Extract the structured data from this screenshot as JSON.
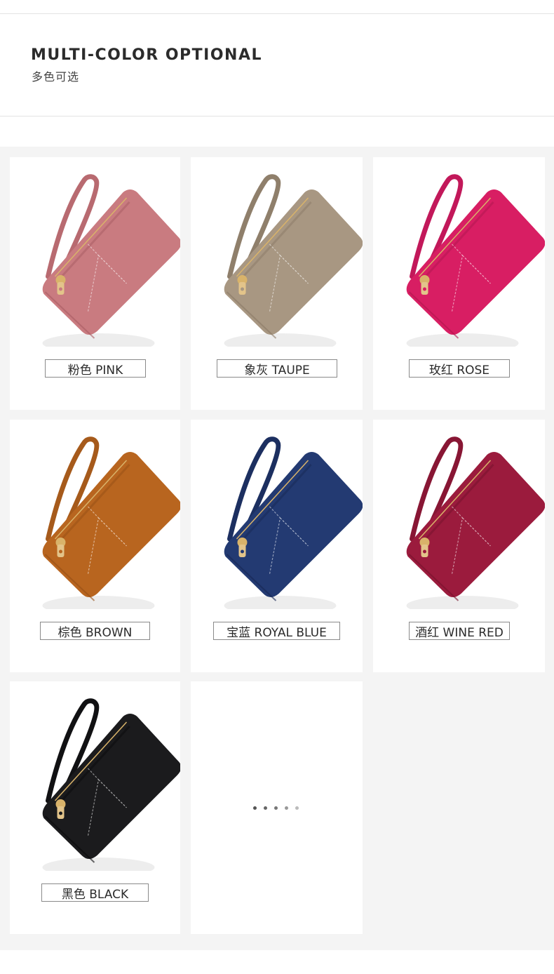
{
  "header": {
    "title_en": "MULTI-COLOR OPTIONAL",
    "title_cn": "多色可选"
  },
  "products": [
    {
      "label": "粉色 PINK",
      "color": "#c97b80",
      "strap": "#b86a70",
      "shade": "#a85c62"
    },
    {
      "label": "象灰 TAUPE",
      "color": "#a89782",
      "strap": "#8f7f6b",
      "shade": "#8a7a66"
    },
    {
      "label": "玫红 ROSE",
      "color": "#d81e63",
      "strap": "#c2185a",
      "shade": "#b0154f"
    },
    {
      "label": "棕色 BROWN",
      "color": "#b8651f",
      "strap": "#a65a1b",
      "shade": "#954f16"
    },
    {
      "label": "宝蓝 ROYAL BLUE",
      "color": "#233a72",
      "strap": "#1c2f60",
      "shade": "#172753"
    },
    {
      "label": "酒红 WINE RED",
      "color": "#9b1b3d",
      "strap": "#881634",
      "shade": "#74122c"
    },
    {
      "label": "黑色 BLACK",
      "color": "#1b1b1d",
      "strap": "#111113",
      "shade": "#0a0a0b"
    }
  ],
  "loading_dots": [
    "#555555",
    "#666666",
    "#777777",
    "#999999",
    "#bbbbbb"
  ]
}
